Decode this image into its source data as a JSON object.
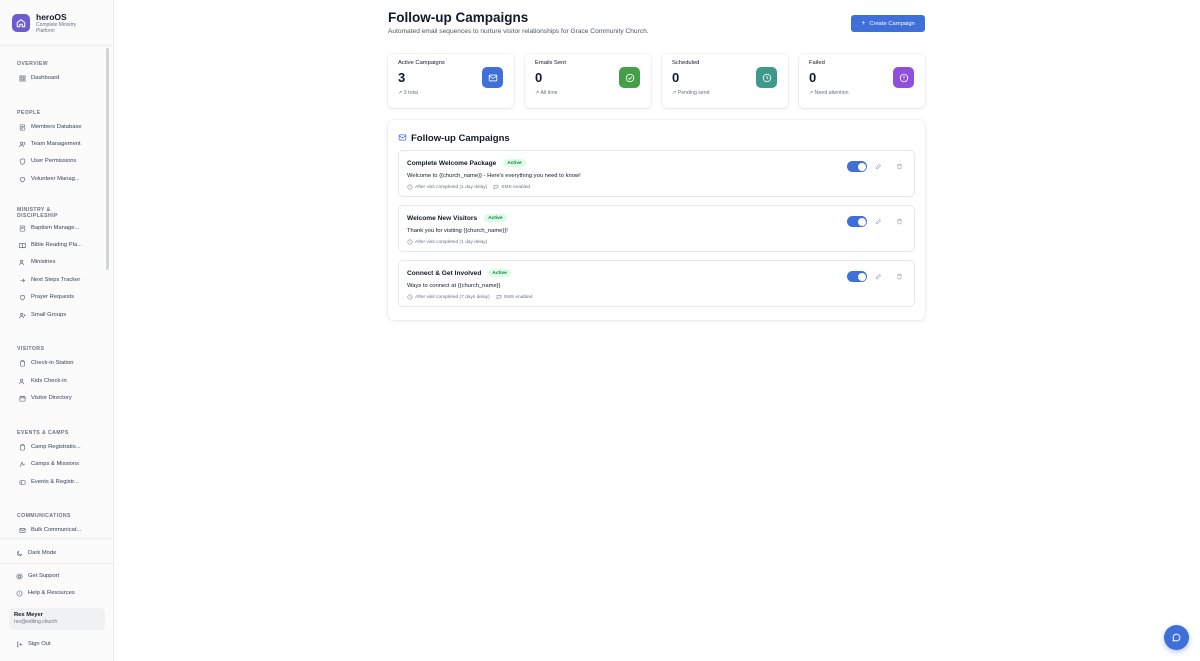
{
  "app": {
    "name": "heroOS",
    "tagline": "Complete Ministry Platform"
  },
  "sidebar": {
    "sections": [
      {
        "title": "OVERVIEW",
        "items": [
          {
            "label": "Dashboard",
            "icon": "dashboard-icon"
          }
        ]
      },
      {
        "title": "PEOPLE",
        "items": [
          {
            "label": "Members Database",
            "icon": "database-icon"
          },
          {
            "label": "Team Management",
            "icon": "users-icon"
          },
          {
            "label": "User Permissions",
            "icon": "shield-icon"
          },
          {
            "label": "Volunteer Manag...",
            "icon": "heart-icon"
          }
        ]
      },
      {
        "title": "MINISTRY & DISCIPLESHIP",
        "items": [
          {
            "label": "Baptism Manage...",
            "icon": "droplet-icon"
          },
          {
            "label": "Bible Reading Pla...",
            "icon": "book-icon"
          },
          {
            "label": "Ministries",
            "icon": "users-icon"
          },
          {
            "label": "Next Steps Tracker",
            "icon": "arrow-right-icon"
          },
          {
            "label": "Prayer Requests",
            "icon": "heart-icon"
          },
          {
            "label": "Small Groups",
            "icon": "user-plus-icon"
          }
        ]
      },
      {
        "title": "VISITORS",
        "items": [
          {
            "label": "Check-in Station",
            "icon": "clipboard-icon"
          },
          {
            "label": "Kids Check-in",
            "icon": "users-icon"
          },
          {
            "label": "Visitor Directory",
            "icon": "calendar-icon"
          }
        ]
      },
      {
        "title": "EVENTS & CAMPS",
        "items": [
          {
            "label": "Camp Registratio...",
            "icon": "clipboard-icon"
          },
          {
            "label": "Camps & Missions",
            "icon": "compass-icon"
          },
          {
            "label": "Events & Registr...",
            "icon": "ticket-icon"
          }
        ]
      },
      {
        "title": "COMMUNICATIONS",
        "items": [
          {
            "label": "Bulk Communicat...",
            "icon": "mail-icon"
          }
        ]
      }
    ],
    "footer": {
      "dark_mode": "Dark Mode",
      "support": "Get Support",
      "help": "Help & Resources",
      "user_name": "Rex Meyer",
      "user_email": "rex@editing.church",
      "sign_out": "Sign Out"
    }
  },
  "header": {
    "title": "Follow-up Campaigns",
    "subtitle": "Automated email sequences to nurture visitor relationships for Grace Community Church.",
    "create_button": "Create Campaign"
  },
  "stats": [
    {
      "label": "Active Campaigns",
      "value": "3",
      "foot": "3 total",
      "icon": "mail-icon",
      "color": "#3f6fd8"
    },
    {
      "label": "Emails Sent",
      "value": "0",
      "foot": "All time",
      "icon": "check-circle-icon",
      "color": "#43a047"
    },
    {
      "label": "Scheduled",
      "value": "0",
      "foot": "Pending send",
      "icon": "clock-icon",
      "color": "#3d9a8b"
    },
    {
      "label": "Failed",
      "value": "0",
      "foot": "Need attention",
      "icon": "alert-circle-icon",
      "color": "#8f4fd8"
    }
  ],
  "list": {
    "title": "Follow-up Campaigns",
    "campaigns": [
      {
        "name": "Complete Welcome Package",
        "status": "Active",
        "subject": "Welcome to {{church_name}} - Here's everything you need to know!",
        "trigger": "After visit completed (1 day delay)",
        "sms": "SMS enabled",
        "enabled": true
      },
      {
        "name": "Welcome New Visitors",
        "status": "Active",
        "subject": "Thank you for visiting {{church_name}}!",
        "trigger": "After visit completed (1 day delay)",
        "sms": "",
        "enabled": true
      },
      {
        "name": "Connect & Get Involved",
        "status": "Active",
        "subject": "Ways to connect at {{church_name}}",
        "trigger": "After visit completed (7 days delay)",
        "sms": "SMS enabled",
        "enabled": true
      }
    ]
  },
  "colors": {
    "accent": "#3f6fd8",
    "badge_bg": "#dcfce7",
    "badge_text": "#15803d"
  }
}
